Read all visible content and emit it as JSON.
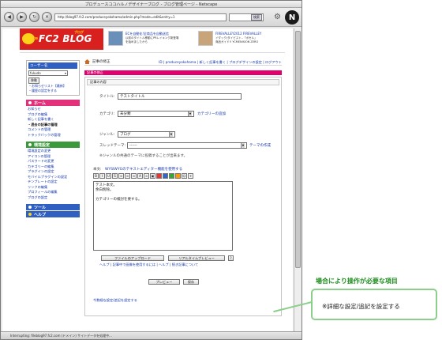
{
  "browser": {
    "title": "プロデュースココハルノデザイナーブログ - ブログ管理ページ - Netscape",
    "url": "http://blog97.fc2.com/produceyokohama/admin.php?mode=edit&entry=1",
    "search_label": "検索",
    "status": "Interrupting: fileblog97.fc2.com (ドメイン) サイトデータを処理中..."
  },
  "banner": {
    "logo": "FC2 BLOG",
    "logo_sub": "ブログ",
    "ad1_title": "ECを自動化!全商品を自動送信",
    "ad1_text": "以前のタイトル移動にPRレイキング新登場\nを始めましたから",
    "ad2_title": "FIREVALLEY2012 FIREVALLEY",
    "ad2_text": "イダック(タイピスト..「ポセル」\n商品ガイド!! YCMENISION ZERO"
  },
  "sidebar": {
    "user_label": "ユーザー名",
    "user_value": "fukudo",
    "go_label": "移動",
    "links": [
      "・お知らせリスト【最新】",
      "・履歴の設定をする"
    ],
    "sections": [
      {
        "title": "ホーム",
        "color": "#e2307a",
        "items": [
          "お知らせ",
          "ブログの編集",
          "新しく記事を書く",
          "・過去の記事の管理",
          "コメントの管理",
          "トラックバックの管理"
        ]
      },
      {
        "title": "環境設定",
        "color": "#3a9a3a",
        "items": [
          "環境設定の変更",
          "アイコンの管理",
          "パスワードの変更",
          "カテゴリーの編集",
          "プラグインの設定",
          "モバイルプラグインの設定",
          "テンプレートの設定",
          "リンクの編集",
          "プロフィールの編集",
          "ブログの設定"
        ]
      }
    ],
    "tool_title": "ツール",
    "tool_color": "#2f5fc1",
    "help_title": "ヘルプ",
    "help_color": "#2f5fc1"
  },
  "main": {
    "breadcrumb": "記事の修正",
    "top_links": "ID | produceyokohama | 新しく記事を書く | ブログデザインの設定 | ログアウト",
    "section_bar": "記事の修正",
    "panel_title": "記事の内容",
    "title_label": "タイトル:",
    "title_value": "テストタイトル",
    "category_label": "カテゴリ:",
    "category_value": "未分類",
    "category_add": "カテゴリーの追加",
    "genre_label": "ジャンル:",
    "genre_value": "ブログ",
    "thread_label": "スレッドテーマ:",
    "thread_value": "------",
    "thread_link": "テーマの作成",
    "genre_note": "※ジャンルの共通のテーマに投稿することが出来ます。",
    "body_label": "本文:",
    "wysiwyg_link": "WYSIWYGのテキストエディター機能を使用する",
    "body_text": [
      "テスト本文。",
      "余白削除。",
      "",
      "カテゴリーの検討を要する。"
    ],
    "upload_button": "ファイルのアップロード",
    "preview_button": "リアルタイムプレビュー",
    "help_links": "ヘルプ | 記事中で画像を使用するには | ヘルプ | 続き記事について",
    "preview_btn2": "プレビュー",
    "save_btn": "保存",
    "detail_link": "今数細な設定/追記を設定する"
  },
  "annotation": {
    "title": "場合により操作が必要な項目",
    "text": "※詳細な設定/追記を設定する"
  }
}
